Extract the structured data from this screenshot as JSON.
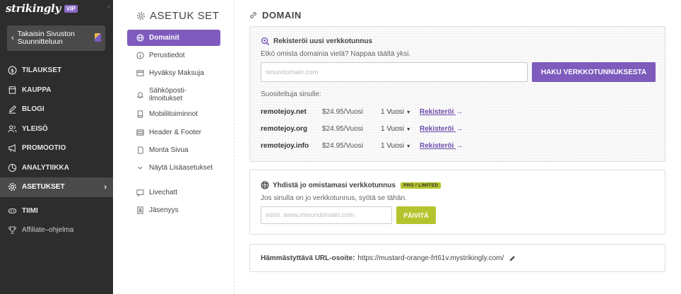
{
  "brand": {
    "logo": "strikingly",
    "badge": "VIP"
  },
  "sidebar": {
    "back_label_line1": "Takaisin Sivuston",
    "back_label_line2": "Suunnitteluun",
    "items": [
      {
        "label": "TILAUKSET",
        "icon": "dollar-circle-icon"
      },
      {
        "label": "KAUPPA",
        "icon": "store-icon"
      },
      {
        "label": "BLOGI",
        "icon": "pen-icon"
      },
      {
        "label": "YLEISÖ",
        "icon": "users-icon"
      },
      {
        "label": "PROMOOTIO",
        "icon": "megaphone-icon"
      },
      {
        "label": "ANALYTIIKKA",
        "icon": "pie-chart-icon"
      },
      {
        "label": "ASETUKSET",
        "icon": "gear-icon"
      },
      {
        "label": "TIIMI",
        "icon": "team-icon"
      },
      {
        "label": "Affiliate–ohjelma",
        "icon": "trophy-icon"
      }
    ]
  },
  "settings": {
    "title": "ASETUK SET",
    "items": [
      {
        "label": "Domainit",
        "icon": "globe-icon"
      },
      {
        "label": "Perustiedot",
        "icon": "info-icon"
      },
      {
        "label": "Hyväksy Maksuja",
        "icon": "card-icon"
      },
      {
        "label_line1": "Sähköposti-",
        "label_line2": "ilmoitukset",
        "icon": "bell-icon"
      },
      {
        "label": "Mobiilitoiminnot",
        "icon": "mobile-icon"
      },
      {
        "label": "Header & Footer",
        "icon": "layout-icon"
      },
      {
        "label": "Monta Sivua",
        "icon": "pages-icon"
      },
      {
        "label": "Näytä Lisäasetukset",
        "icon": "chevron-down-icon"
      },
      {
        "label": "Livechatt",
        "icon": "chat-icon"
      },
      {
        "label": "Jäsenyys",
        "icon": "member-icon"
      }
    ]
  },
  "main": {
    "title": "DOMAIN",
    "register": {
      "heading": "Rekisteröi uusi verkkotunnus",
      "subtext": "Etkö omista domainia vielä? Nappaa täältä yksi.",
      "input_placeholder": "sinundomain.com",
      "search_button": "HAKU VERKKOTUNNUKSESTA",
      "suggestions_label": "Suositeltuja sinulle:",
      "suggestions": [
        {
          "domain": "remotejoy.net",
          "price": "$24.95/Vuosi",
          "term": "1 Vuosi",
          "action": "Rekisteröi"
        },
        {
          "domain": "remotejoy.org",
          "price": "$24.95/Vuosi",
          "term": "1 Vuosi",
          "action": "Rekisteröi"
        },
        {
          "domain": "remotejoy.info",
          "price": "$24.95/Vuosi",
          "term": "1 Vuosi",
          "action": "Rekisteröi"
        }
      ]
    },
    "connect": {
      "heading": "Yhdistä jo omistamasi verkkotunnus",
      "badge": "PRO / LIMITED",
      "subtext": "Jos sinulla on jo verkkotunnus, syötä se tähän.",
      "input_placeholder": "esim. www.minundomain.com",
      "update_button": "PÄIVITÄ"
    },
    "url": {
      "label": "Hämmästyttävä URL-osoite:",
      "value": "https://mustard-orange-frt61v.mystrikingly.com/"
    }
  },
  "colors": {
    "sidebar_bg": "#2d2d2d",
    "accent_purple": "#7e5bbd",
    "accent_green": "#b5c42e"
  }
}
